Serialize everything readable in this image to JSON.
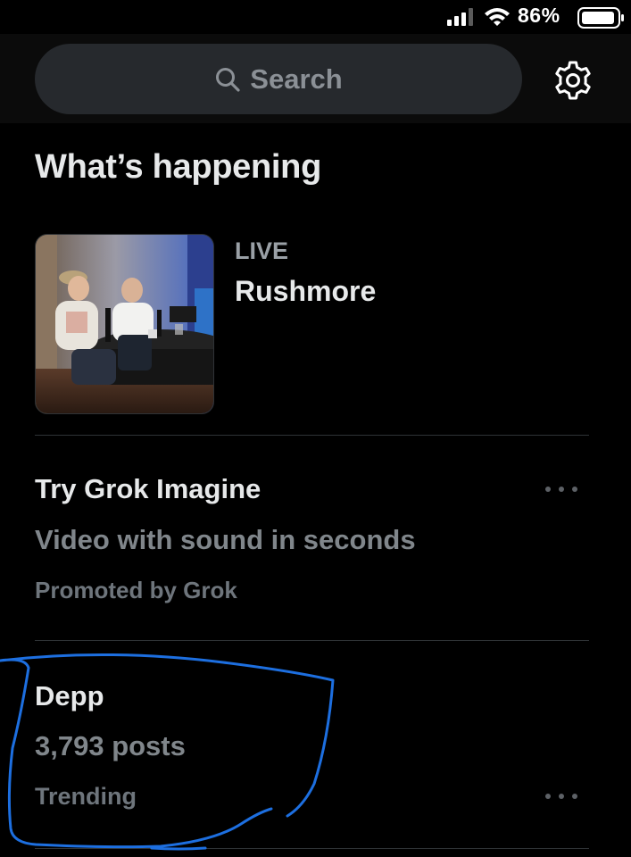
{
  "status_bar": {
    "battery_percent": "86%",
    "signal_icon": "cellular-signal-icon",
    "wifi_icon": "wifi-icon",
    "battery_icon": "battery-icon"
  },
  "header": {
    "search_placeholder": "Search",
    "search_icon": "search-icon",
    "settings_icon": "gear-icon"
  },
  "section": {
    "title": "What’s happening"
  },
  "live_item": {
    "label": "LIVE",
    "title": "Rushmore"
  },
  "promoted_item": {
    "title": "Try Grok Imagine",
    "subtitle": "Video with sound in seconds",
    "promoted_by": "Promoted by Grok",
    "more_icon": "more-options-icon"
  },
  "trend_item": {
    "title": "Depp",
    "post_count": "3,793 posts",
    "context": "Trending",
    "more_icon": "more-options-icon"
  },
  "colors": {
    "background": "#000000",
    "header_background": "#0b0b0b",
    "search_background": "#26292d",
    "primary_text": "#e7e9ea",
    "secondary_text": "#80868b",
    "divider": "#2f3336",
    "annotation_stroke": "#1d6fe0"
  }
}
